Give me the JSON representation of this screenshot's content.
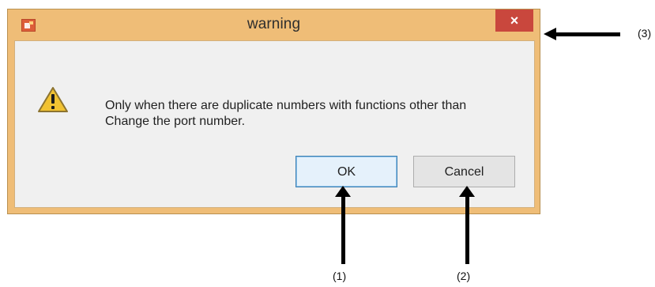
{
  "window": {
    "title": "warning",
    "close_glyph": "×"
  },
  "dialog": {
    "message_lines": [
      "Only when there are duplicate numbers with functions other than",
      "Change the port number."
    ],
    "buttons": {
      "ok_label": "OK",
      "cancel_label": "Cancel"
    },
    "icons": {
      "app": "app-icon",
      "warning": "warning-icon",
      "close": "close-icon"
    }
  },
  "annotations": {
    "close_label": "(3)",
    "ok_label": "(1)",
    "cancel_label": "(2)"
  },
  "colors": {
    "window_frame": "#efbd77",
    "close_button": "#c9473d",
    "content_background": "#f0f0f0",
    "ok_focus": "#3c7fb1"
  }
}
